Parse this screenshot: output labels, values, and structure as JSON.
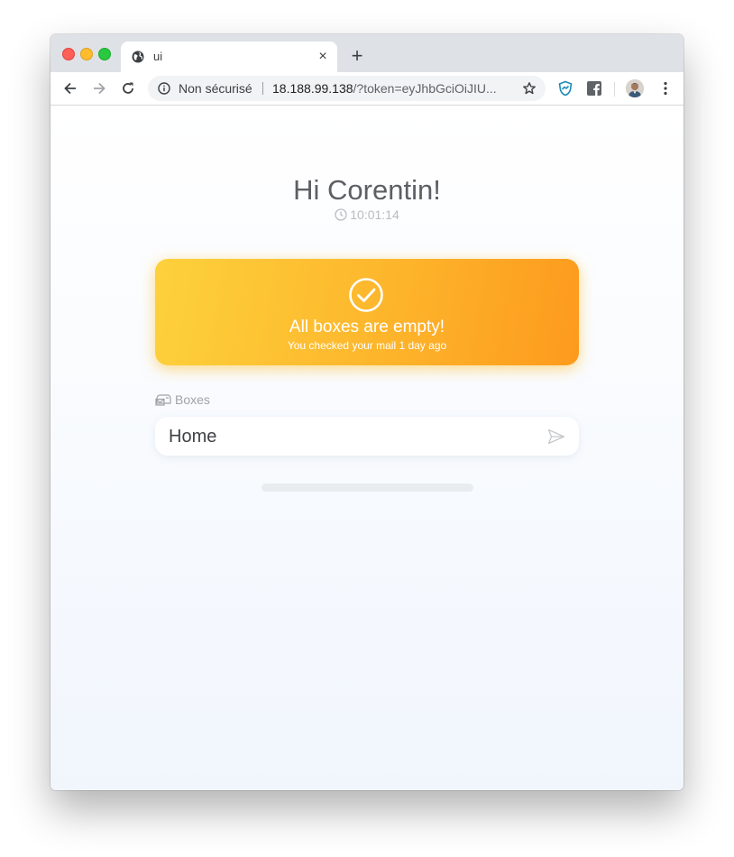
{
  "browser": {
    "tab_title": "ui",
    "tab_close": "×",
    "new_tab": "+",
    "omnibox": {
      "security_label": "Non sécurisé",
      "url_host": "18.188.99.138",
      "url_rest": "/?token=eyJhbGciOiJIU..."
    }
  },
  "page": {
    "greeting": "Hi Corentin!",
    "time": "10:01:14",
    "status": {
      "title": "All boxes are empty!",
      "subtitle": "You checked your mail 1 day ago"
    },
    "boxes": {
      "section_label": "Boxes",
      "items": [
        {
          "name": "Home"
        }
      ]
    },
    "progress": 0
  },
  "colors": {
    "status_gradient_start": "#fdd13c",
    "status_gradient_end": "#fd9a1d",
    "greeting_text": "#5d5f63"
  },
  "icons": [
    "globe-icon",
    "close-icon",
    "plus-icon",
    "back-icon",
    "forward-icon",
    "reload-icon",
    "info-icon",
    "star-icon",
    "shield-extension-icon",
    "facebook-extension-icon",
    "avatar",
    "menu-icon",
    "clock-icon",
    "check-circle-icon",
    "mailbox-icon",
    "send-icon"
  ]
}
